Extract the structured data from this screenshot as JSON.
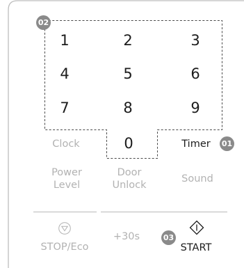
{
  "keypad": {
    "keys": [
      "1",
      "2",
      "3",
      "4",
      "5",
      "6",
      "7",
      "8",
      "9",
      "0"
    ]
  },
  "functions": {
    "clock": "Clock",
    "timer": "Timer",
    "power_level_line1": "Power",
    "power_level_line2": "Level",
    "door_unlock_line1": "Door",
    "door_unlock_line2": "Unlock",
    "sound": "Sound",
    "stop_eco": "STOP/Eco",
    "plus30s": "+30s",
    "start": "START"
  },
  "callouts": {
    "timer": "01",
    "keypad": "02",
    "start": "03"
  },
  "colors": {
    "text_dark": "#1c1c1c",
    "text_light": "#b2b2b2",
    "badge": "#8a8a8a"
  }
}
